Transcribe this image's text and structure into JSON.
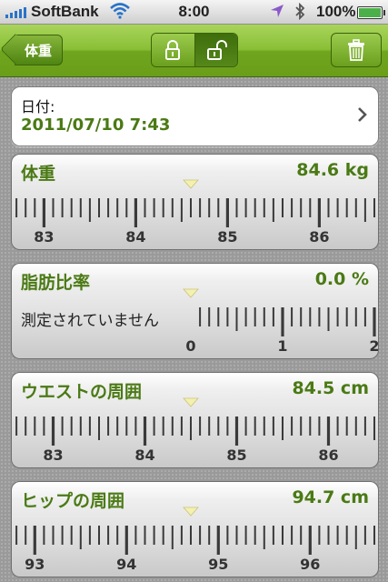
{
  "status": {
    "carrier": "SoftBank",
    "time": "8:00",
    "battery": "100%",
    "battery_level": 1.0,
    "icons": [
      "signal-icon",
      "wifi-icon",
      "location-icon",
      "bluetooth-icon",
      "battery-icon"
    ]
  },
  "nav": {
    "back_label": "体重",
    "segment_icons": [
      "lock-closed-icon",
      "lock-open-icon"
    ],
    "selected_segment": 1,
    "trash_icon": "trash-icon"
  },
  "date": {
    "label": "日付:",
    "value": "2011/07/10 7:43"
  },
  "measurements": [
    {
      "title": "体重",
      "value": "84.6 kg",
      "note": "",
      "reading": 84.6,
      "labels": [
        "83",
        "84",
        "85",
        "86"
      ]
    },
    {
      "title": "脂肪比率",
      "value": "0.0 %",
      "note": "測定されていません",
      "reading": 0.0,
      "labels": [
        "0",
        "1",
        "2"
      ]
    },
    {
      "title": "ウエストの周囲",
      "value": "84.5 cm",
      "note": "",
      "reading": 84.5,
      "labels": [
        "83",
        "84",
        "85",
        "86"
      ]
    },
    {
      "title": "ヒップの周囲",
      "value": "94.7 cm",
      "note": "",
      "reading": 94.7,
      "labels": [
        "93",
        "94",
        "95",
        "96"
      ]
    }
  ],
  "colors": {
    "accent_green": "#4a7a14",
    "nav_green": "#89bf35",
    "signal_blue": "#2a73c8",
    "pointer_yellow": "#f4f0b0"
  }
}
